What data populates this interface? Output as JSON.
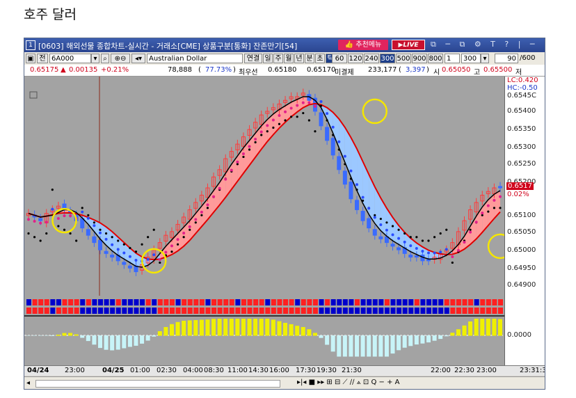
{
  "page_heading": "호주 달러",
  "window": {
    "number": "1",
    "title": "[0603] 해외선물 종합차트-실시간 - 거래소[CME] 상품구분[통화] 잔존만기[54]",
    "recommend_label": "추천메뉴",
    "live_label": "LIVE",
    "title_icons": "⧉ ─ ⧉ ⚙ T ? | ─ □ ×"
  },
  "toolbar": {
    "mode_label": "전",
    "symbol": "6A000",
    "search_icon": "magnifier",
    "instrument_name": "Australian Dollar",
    "periods": [
      "연결",
      "일",
      "주",
      "월",
      "년",
      "분",
      "초",
      "틱"
    ],
    "selected_period": "틱",
    "intervals": [
      "60",
      "120",
      "240",
      "300",
      "500",
      "900",
      "800"
    ],
    "selected_interval": "300",
    "count_field": "1",
    "bar_count": "300",
    "zoom_value": "90",
    "zoom_max": "/600"
  },
  "quote": {
    "price": "0.65175",
    "change_arrow": "▲",
    "change": "0.00135",
    "change_pct": "+0.21%",
    "volume": "78,888",
    "volume_ratio": "77.73%",
    "best_bid_label": "최우선",
    "best_bid": "0.65180",
    "best_ask": "0.65170",
    "open_interest_label": "미결제",
    "open_interest": "233,177",
    "oi_change": "3,397",
    "open_label": "시",
    "open": "0.65050",
    "high_label": "고",
    "high": "0.65500",
    "low_label": "저"
  },
  "price_axis": {
    "lc_label": "LC:0.420",
    "hc_label": "HC:-0.50",
    "ticks": [
      "0.6545C",
      "0.65400",
      "0.65350",
      "0.65300",
      "0.65250",
      "0.65200",
      "0.65100",
      "0.65050",
      "0.65000",
      "0.64950",
      "0.64900"
    ],
    "current_price_tag": "0.6517",
    "current_pct_tag": "0.02%",
    "indicator_tick": "0.0000"
  },
  "time_axis": {
    "labels": [
      "04/24",
      "23:00",
      "04/25",
      "01:00",
      "02:30",
      "04:00",
      "08:30",
      "11:00",
      "14:30",
      "16:00",
      "17:30",
      "19:30",
      "21:30",
      "22:00",
      "22:30",
      "23:00",
      "23:31:3"
    ]
  },
  "scroll_tools": "▸|◂ ■ ▸▸  ⊞ ⊟ ⟋ ∕∕ ⟑ ⊡ Q − + A",
  "colors": {
    "chart_bg": "#a3a3a3",
    "up_candle": "#ff3b3b",
    "down_candle": "#3a6bff",
    "red_ma": "#e00000",
    "black_ma": "#000000",
    "up_fill": "#ff9a9a",
    "down_fill": "#9cc8ff",
    "highlight_circle": "#f5e600",
    "hist_pos": "#f0f000",
    "hist_neg": "#c8f4f8"
  },
  "chart_data": {
    "type": "candlestick",
    "ylim": [
      0.6488,
      0.6546
    ],
    "bars": 80,
    "close": [
      0.651,
      0.6509,
      0.6508,
      0.651,
      0.6511,
      0.6512,
      0.6511,
      0.651,
      0.6508,
      0.6506,
      0.6504,
      0.6502,
      0.65,
      0.6499,
      0.6498,
      0.6497,
      0.6496,
      0.6495,
      0.6494,
      0.6496,
      0.6498,
      0.65,
      0.6502,
      0.6504,
      0.6505,
      0.6507,
      0.6509,
      0.6511,
      0.6513,
      0.6515,
      0.6517,
      0.652,
      0.6522,
      0.6525,
      0.6527,
      0.6529,
      0.6531,
      0.6533,
      0.6535,
      0.6537,
      0.6538,
      0.6539,
      0.654,
      0.6541,
      0.6542,
      0.6542,
      0.6543,
      0.6541,
      0.6538,
      0.6534,
      0.653,
      0.6526,
      0.6522,
      0.6518,
      0.6514,
      0.6511,
      0.6508,
      0.6506,
      0.6504,
      0.6503,
      0.6502,
      0.6501,
      0.65,
      0.6499,
      0.6498,
      0.6498,
      0.6497,
      0.6497,
      0.6498,
      0.6499,
      0.65,
      0.6502,
      0.6505,
      0.6508,
      0.6511,
      0.6513,
      0.6515,
      0.6516,
      0.6517,
      0.6517
    ],
    "annotations": [
      "highlight circles at trend reversals"
    ]
  }
}
